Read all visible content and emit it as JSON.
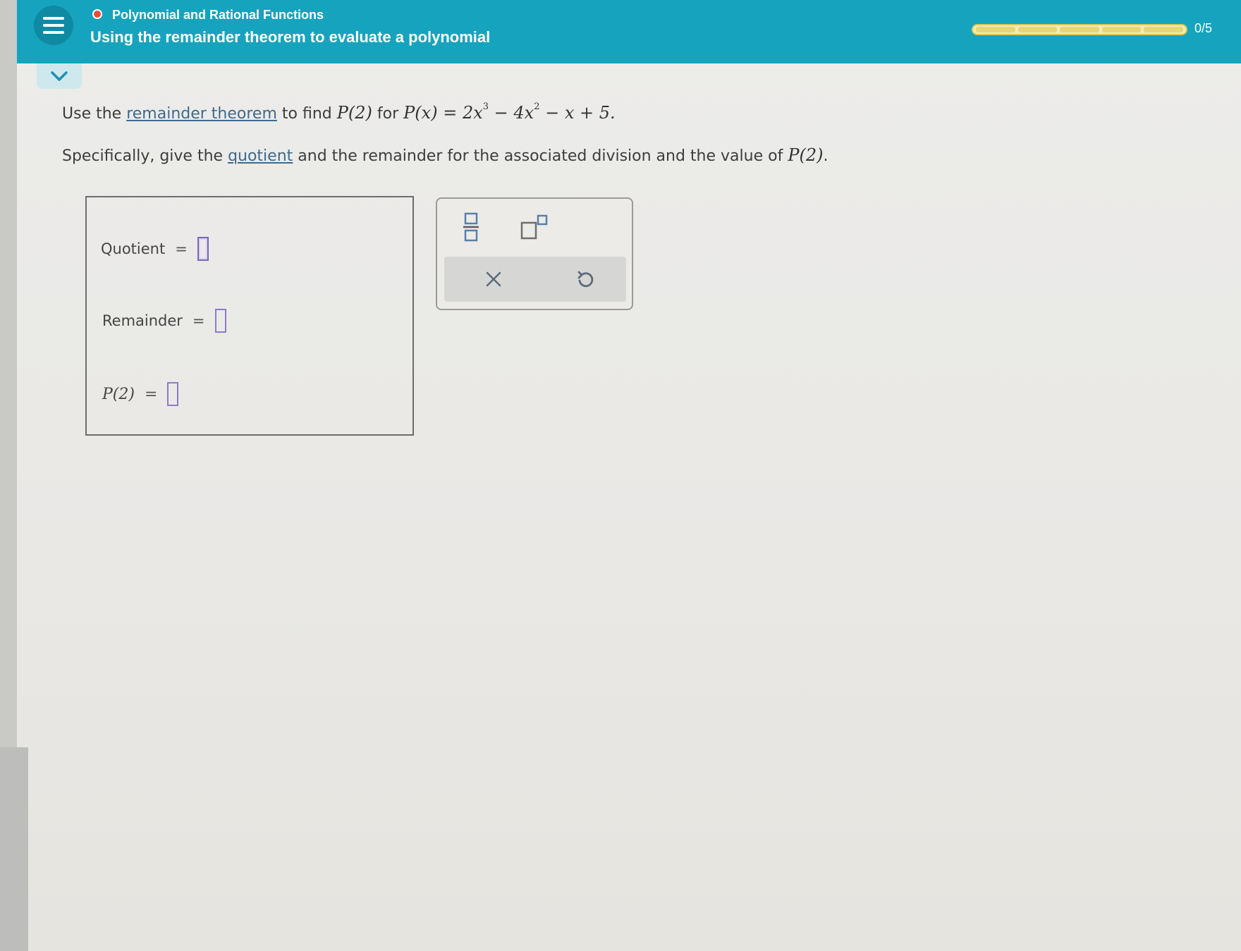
{
  "header": {
    "topic": "Polynomial and Rational Functions",
    "lesson_title": "Using the remainder theorem to evaluate a polynomial",
    "progress": {
      "label": "0/5",
      "completed": 0,
      "total": 5
    },
    "accent_color": "#16a3bd",
    "topic_dot_color": "#e84a3b"
  },
  "icons": {
    "menu": "hamburger-menu-icon",
    "collapse": "chevron-down-icon",
    "fraction": "fraction-template-icon",
    "exponent": "exponent-template-icon",
    "clear": "close-icon",
    "undo": "undo-icon"
  },
  "problem": {
    "line1": {
      "prefix": "Use the ",
      "link": "remainder theorem",
      "mid": " to find ",
      "eval": "P(2)",
      "for": " for ",
      "poly_lhs": "P(x)",
      "poly_eq": " = ",
      "term1_coef": "2x",
      "term1_exp": "3",
      "term2": " − 4x",
      "term2_exp": "2",
      "term3": " − x + 5."
    },
    "line2": {
      "prefix": "Specifically, give the ",
      "link": "quotient",
      "suffix": " and the remainder for the associated division and the value of ",
      "eval": "P(2)",
      "end": "."
    }
  },
  "answers": {
    "quotient_label": "Quotient",
    "remainder_label": "Remainder",
    "value_label": "P(2)",
    "equals": "=",
    "quotient_value": "",
    "remainder_value": "",
    "value_value": ""
  }
}
